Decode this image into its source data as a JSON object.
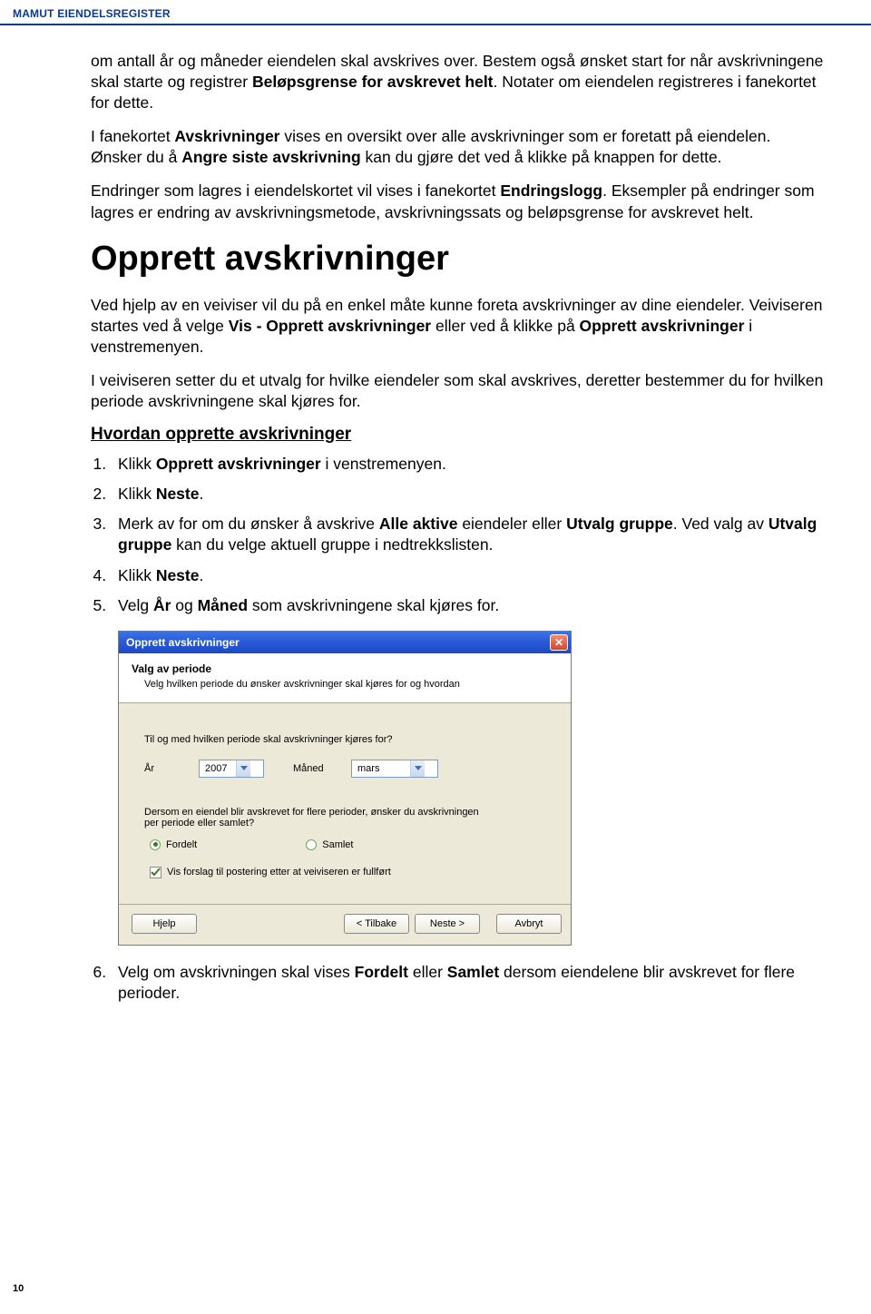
{
  "header": "MAMUT EIENDELSREGISTER",
  "para1_pre": "om antall år og måneder eiendelen skal avskrives over. Bestem også ønsket start for når avskrivningene skal starte og registrer ",
  "para1_b1": "Beløpsgrense for avskrevet helt",
  "para1_post": ". Notater om eiendelen registreres i fanekortet for dette.",
  "para2a": "I fanekortet ",
  "para2b": "Avskrivninger",
  "para2c": " vises en oversikt over alle avskrivninger som er foretatt på eiendelen. Ønsker du å ",
  "para2d": "Angre siste avskrivning",
  "para2e": " kan du gjøre det ved å klikke på knappen for dette.",
  "para3a": "Endringer som lagres i eiendelskortet vil vises i fanekortet ",
  "para3b": "Endringslogg",
  "para3c": ". Eksempler på endringer som lagres er endring av avskrivningsmetode, avskrivningssats og beløpsgrense for avskrevet helt.",
  "h1": "Opprett avskrivninger",
  "para4a": "Ved hjelp av en veiviser vil du på en enkel måte kunne foreta avskrivninger av dine eiendeler. Veiviseren startes ved å velge ",
  "para4b": "Vis - Opprett avskrivninger",
  "para4c": " eller ved å klikke på ",
  "para4d": "Opprett avskrivninger",
  "para4e": " i venstremenyen.",
  "para5": "I veiviseren setter du et utvalg for hvilke eiendeler som skal avskrives, deretter bestemmer du for hvilken periode avskrivningene skal kjøres for.",
  "subhead": "Hvordan opprette avskrivninger",
  "steps": {
    "s1a": "Klikk ",
    "s1b": "Opprett avskrivninger",
    "s1c": " i venstremenyen.",
    "s2a": "Klikk ",
    "s2b": "Neste",
    "s2c": ".",
    "s3a": "Merk av for om du ønsker å avskrive ",
    "s3b": "Alle aktive",
    "s3c": " eiendeler eller ",
    "s3d": "Utvalg gruppe",
    "s3e": ". Ved valg av ",
    "s3f": "Utvalg gruppe",
    "s3g": " kan du velge aktuell gruppe i nedtrekkslisten.",
    "s4a": "Klikk ",
    "s4b": "Neste",
    "s4c": ".",
    "s5a": "Velg ",
    "s5b": "År",
    "s5c": " og ",
    "s5d": "Måned",
    "s5e": " som avskrivningene skal kjøres for.",
    "s6a": "Velg om avskrivningen skal vises ",
    "s6b": "Fordelt",
    "s6c": " eller ",
    "s6d": "Samlet",
    "s6e": " dersom eiendelene blir avskrevet for flere perioder."
  },
  "dialog": {
    "title": "Opprett avskrivninger",
    "headTitle": "Valg av periode",
    "headSub": "Velg hvilken periode du ønsker avskrivninger skal kjøres for og hvordan",
    "q1": "Til og med hvilken periode skal avskrivninger kjøres for?",
    "yearLabel": "År",
    "yearValue": "2007",
    "monthLabel": "Måned",
    "monthValue": "mars",
    "q2a": "Dersom en eiendel blir avskrevet for flere perioder, ønsker du avskrivningen",
    "q2b": "per periode eller samlet?",
    "radio1": "Fordelt",
    "radio2": "Samlet",
    "check1": "Vis forslag til postering etter at veiviseren er fullført",
    "btnHelp": "Hjelp",
    "btnBack": "< Tilbake",
    "btnNext": "Neste >",
    "btnCancel": "Avbryt"
  },
  "pageNum": "10"
}
